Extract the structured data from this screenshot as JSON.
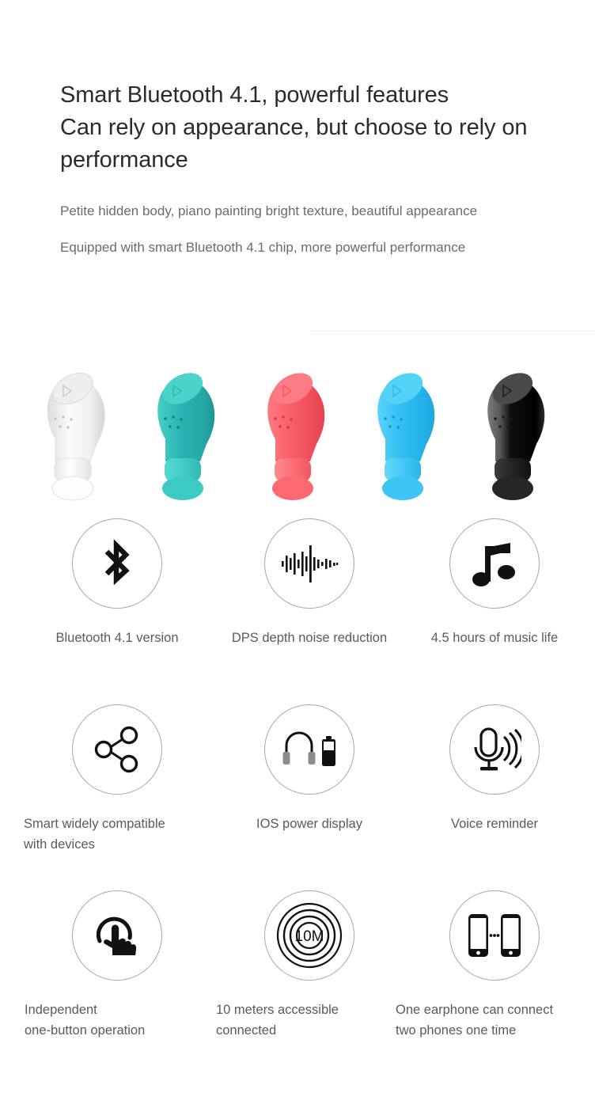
{
  "header": {
    "headline": "Smart Bluetooth 4.1, powerful features",
    "subhead": "Can rely on appearance, but choose to rely on performance",
    "paragraph_1": "Petite hidden body, piano painting bright texture, beautiful appearance",
    "paragraph_2": "Equipped with smart Bluetooth 4.1 chip, more powerful performance"
  },
  "colors": {
    "headline_text": "#2b2b2b",
    "body_text": "#6b6b6b",
    "label_text": "#5a5a5a",
    "circle_stroke": "#aba5a5",
    "icon_fill": "#111111",
    "background": "#ffffff"
  },
  "product_swatches": [
    {
      "name": "white",
      "label": "White",
      "body": "#f4f4f4",
      "body_dark": "#dcdcdc",
      "tip": "#ffffff",
      "tip_dark": "#e6e6e6",
      "cap": "#e8e8e8"
    },
    {
      "name": "teal",
      "label": "Teal",
      "body": "#2cb7b4",
      "body_dark": "#1f9c99",
      "tip": "#46cfc6",
      "tip_dark": "#33bdb5",
      "cap": "#48cfc8"
    },
    {
      "name": "red",
      "label": "Red",
      "body": "#f55b66",
      "body_dark": "#e04550",
      "tip": "#fb6a72",
      "tip_dark": "#ef525c",
      "cap": "#fd7a80"
    },
    {
      "name": "blue",
      "label": "Blue",
      "body": "#2fbdf2",
      "body_dark": "#1fa9de",
      "tip": "#45c8f6",
      "tip_dark": "#2bb5e8",
      "cap": "#5ad2f8"
    },
    {
      "name": "black",
      "label": "Black",
      "body": "#131313",
      "body_dark": "#000000",
      "tip": "#2a2a2a",
      "tip_dark": "#171717",
      "cap": "#5b5b5b"
    }
  ],
  "features": [
    {
      "row": 1,
      "items": [
        {
          "icon": "bluetooth-icon",
          "label": "Bluetooth 4.1 version"
        },
        {
          "icon": "waveform-icon",
          "label": "DPS depth noise reduction"
        },
        {
          "icon": "music-note-icon",
          "label": "4.5 hours of music life"
        }
      ]
    },
    {
      "row": 2,
      "items": [
        {
          "icon": "share-nodes-icon",
          "label": "Smart widely compatible\nwith devices"
        },
        {
          "icon": "headphone-battery-icon",
          "label": "IOS power display"
        },
        {
          "icon": "microphone-icon",
          "label": "Voice reminder"
        }
      ]
    },
    {
      "row": 3,
      "items": [
        {
          "icon": "touch-hand-icon",
          "label": "Independent\none-button operation"
        },
        {
          "icon": "range-10m-icon",
          "label": "10 meters accessible\nconnected"
        },
        {
          "icon": "two-phones-icon",
          "label": "One earphone can connect\ntwo phones one time"
        }
      ]
    }
  ],
  "icon_text": {
    "range_label": "10M"
  }
}
